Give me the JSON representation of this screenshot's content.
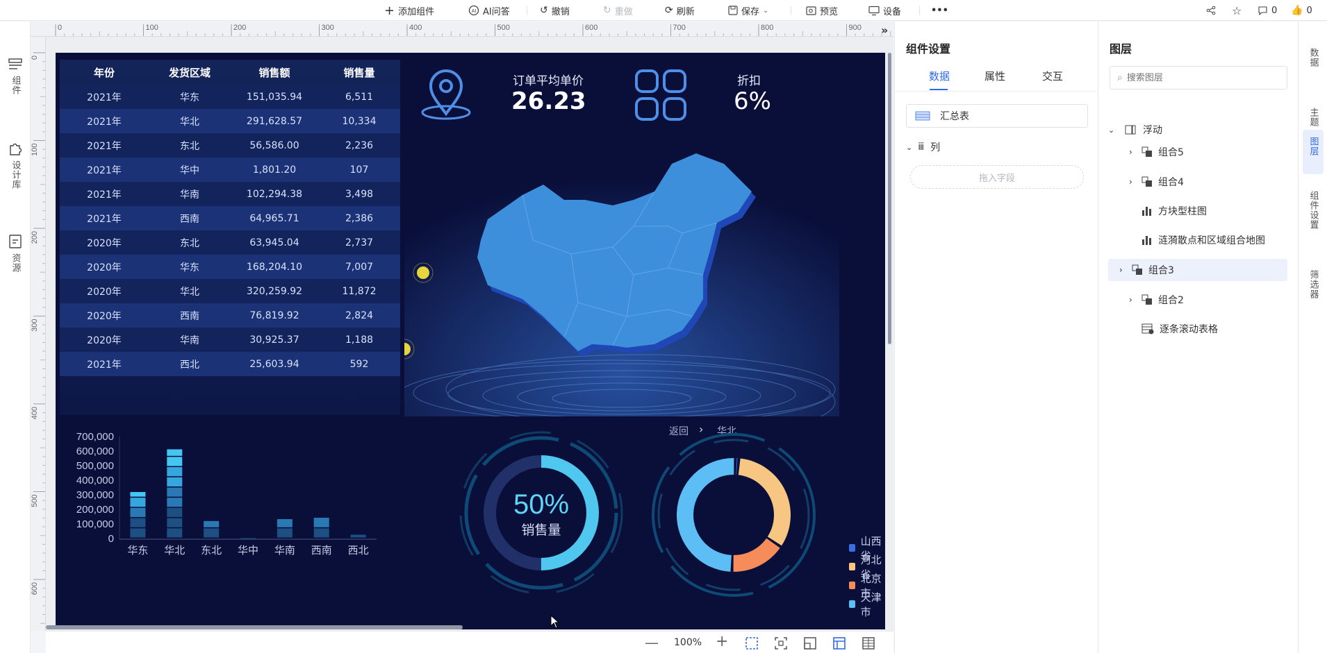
{
  "toolbar": {
    "add_component": "添加组件",
    "ai_qa": "AI问答",
    "undo": "撤销",
    "redo": "重做",
    "refresh": "刷新",
    "save": "保存",
    "preview": "预览",
    "device": "设备",
    "more": "•••",
    "comment_count": "0",
    "like_count": "0"
  },
  "left_rail": {
    "components": "组件",
    "design_lib": "设计库",
    "resources": "资源"
  },
  "ruler": {
    "h_ticks": [
      "0",
      "100",
      "200",
      "300",
      "400",
      "500",
      "600",
      "700",
      "800",
      "900"
    ],
    "v_ticks": [
      "0",
      "100",
      "200",
      "300",
      "400",
      "500",
      "600"
    ]
  },
  "table": {
    "headers": [
      "年份",
      "发货区域",
      "销售额",
      "销售量"
    ],
    "rows": [
      [
        "2021年",
        "华东",
        "151,035.94",
        "6,511"
      ],
      [
        "2021年",
        "华北",
        "291,628.57",
        "10,334"
      ],
      [
        "2021年",
        "东北",
        "56,586.00",
        "2,236"
      ],
      [
        "2021年",
        "华中",
        "1,801.20",
        "107"
      ],
      [
        "2021年",
        "华南",
        "102,294.38",
        "3,498"
      ],
      [
        "2021年",
        "西南",
        "64,965.71",
        "2,386"
      ],
      [
        "2020年",
        "东北",
        "63,945.04",
        "2,737"
      ],
      [
        "2020年",
        "华东",
        "168,204.10",
        "7,007"
      ],
      [
        "2020年",
        "华北",
        "320,259.92",
        "11,872"
      ],
      [
        "2020年",
        "西南",
        "76,819.92",
        "2,824"
      ],
      [
        "2020年",
        "华南",
        "30,925.37",
        "1,188"
      ],
      [
        "2021年",
        "西北",
        "25,603.94",
        "592"
      ]
    ]
  },
  "kpi": {
    "avg_price_label": "订单平均单价",
    "avg_price_value": "26.23",
    "discount_label": "折扣",
    "discount_value": "6%"
  },
  "chart_data": [
    {
      "type": "bar",
      "categories": [
        "华东",
        "华北",
        "东北",
        "华中",
        "华南",
        "西南",
        "西北"
      ],
      "values": [
        319000,
        612000,
        120000,
        2000,
        133000,
        141000,
        26000
      ],
      "ylim": [
        0,
        700000
      ],
      "yticks": [
        "0",
        "100,000",
        "200,000",
        "300,000",
        "400,000",
        "500,000",
        "600,000",
        "700,000"
      ],
      "colors": [
        "#1d4f82",
        "#2a79b4",
        "#35a6de",
        "#45c6f2"
      ]
    },
    {
      "type": "pie",
      "center_value": "50%",
      "center_label": "销售量",
      "values": [
        50,
        50
      ],
      "colors": [
        "#4fc7ee",
        "#243066"
      ]
    },
    {
      "type": "pie",
      "categories": [
        "山西省",
        "河北省",
        "北京市",
        "天津市"
      ],
      "values": [
        1,
        33,
        16,
        50
      ],
      "colors": [
        "#3a6fe0",
        "#f7c682",
        "#f58c5a",
        "#5cbef5"
      ]
    }
  ],
  "drill": {
    "back": "返回",
    "current": "华北"
  },
  "settings_panel": {
    "title": "组件设置",
    "tabs": [
      "数据",
      "属性",
      "交互"
    ],
    "dataset": "汇总表",
    "columns_label": "列",
    "drop_hint": "拖入字段"
  },
  "layers_panel": {
    "title": "图层",
    "search_placeholder": "搜索图层",
    "root": "浮动",
    "items": [
      "组合5",
      "组合4",
      "方块型柱图",
      "涟漪散点和区域组合地图",
      "组合3",
      "组合2",
      "逐条滚动表格"
    ]
  },
  "right_rail": {
    "data": "数据",
    "theme": "主题",
    "layers": "图层",
    "comp_settings": "组件设置",
    "filter": "筛选器"
  },
  "zoom": {
    "value": "100%"
  }
}
